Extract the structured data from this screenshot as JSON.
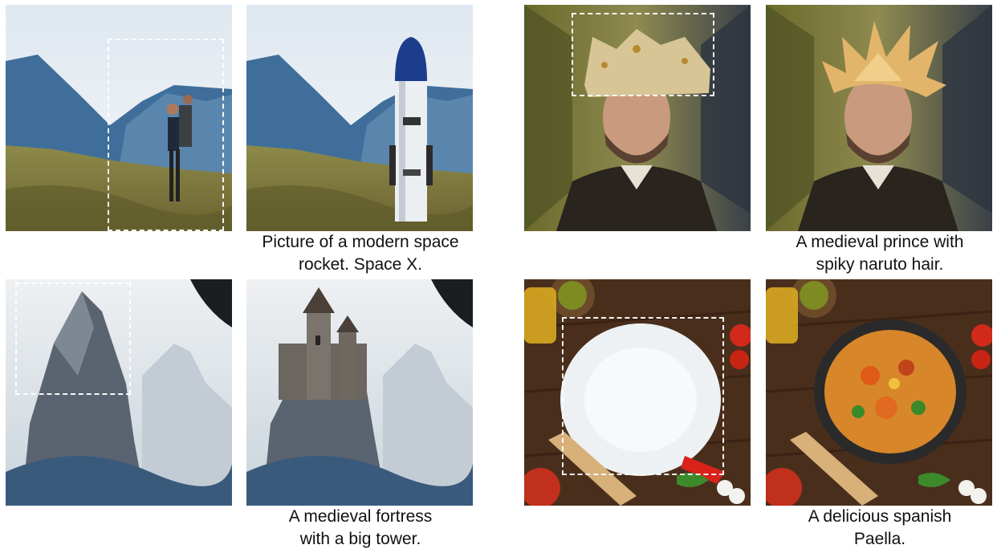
{
  "figure": {
    "examples": [
      {
        "id": "rocket",
        "caption": "Picture of a modern space\nrocket. Space X.",
        "input_scene": "hiker on mountain meadow",
        "output_scene": "rocket on mountain meadow"
      },
      {
        "id": "prince",
        "caption": "A medieval prince with\nspiky naruto hair.",
        "input_scene": "man wearing crown in cloister",
        "output_scene": "man with spiky blond hair in cloister"
      },
      {
        "id": "fortress",
        "caption": "A medieval fortress\n with a big tower.",
        "input_scene": "rocky peak above clouds",
        "output_scene": "fortress tower on rocky peak"
      },
      {
        "id": "paella",
        "caption": "A delicious spanish\nPaella.",
        "input_scene": "flour on wooden table with ingredients",
        "output_scene": "paella pan on wooden table with ingredients"
      }
    ],
    "mask_style": "white-dashed-rectangle",
    "colors": {
      "mask": "#ffffff",
      "caption": "#111111",
      "background": "#ffffff"
    }
  }
}
